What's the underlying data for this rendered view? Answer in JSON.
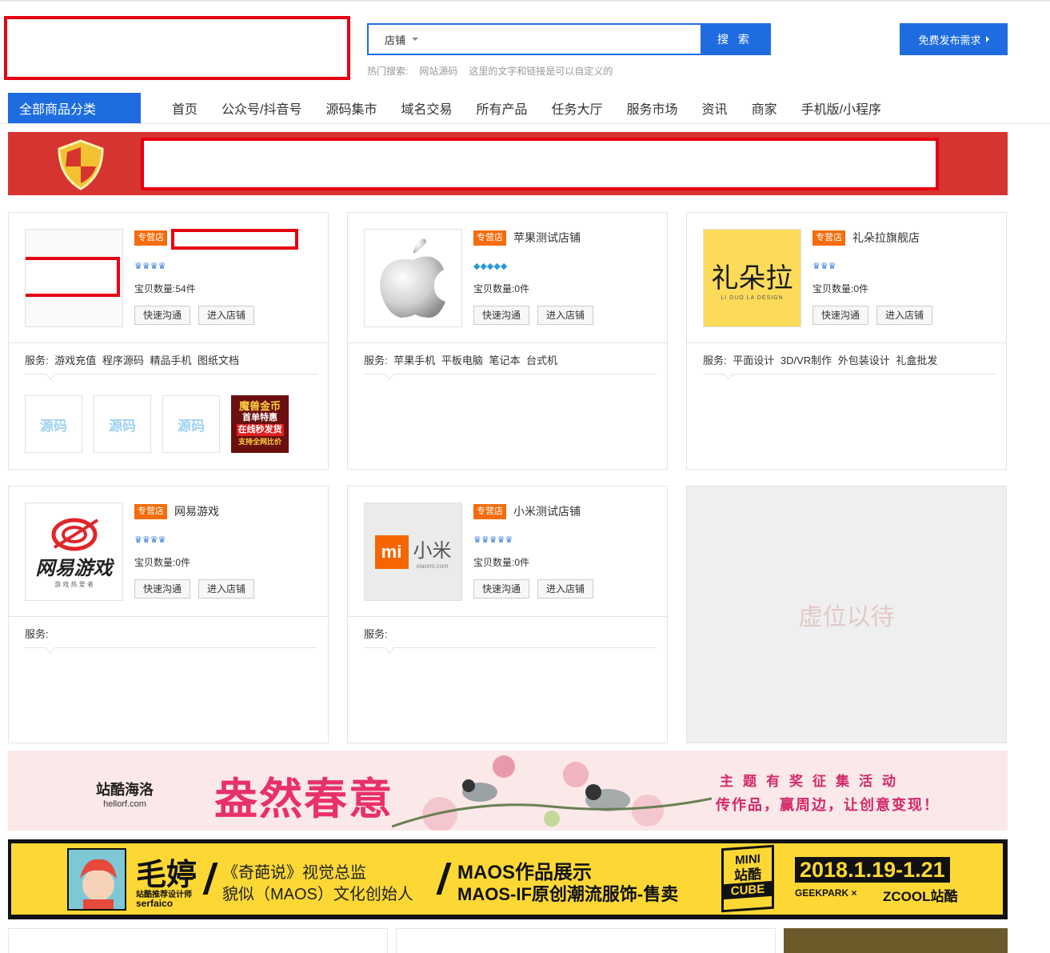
{
  "search": {
    "type_label": "店铺",
    "placeholder": "",
    "button_label": "搜 索",
    "hot_label": "热门搜索:",
    "hot_terms": [
      "网站源码",
      "这里的文字和链接是可以自定义的"
    ]
  },
  "publish_label": "免费发布需求",
  "nav": {
    "all_categories": "全部商品分类",
    "items": [
      "首页",
      "公众号/抖音号",
      "源码集市",
      "域名交易",
      "所有产品",
      "任务大厅",
      "服务市场",
      "资讯",
      "商家",
      "手机版/小程序"
    ]
  },
  "shops": [
    {
      "badge": "专营店",
      "name": "",
      "rating_icons": "♛♛♛♛",
      "count": "宝贝数量:54件",
      "chat_label": "快速沟通",
      "enter_label": "进入店铺",
      "services": "服务: 游戏充值 程序源码 精品手机 图纸文档",
      "products": [
        "源码",
        "源码",
        "源码"
      ],
      "gold_product": [
        "魔兽金币",
        "首单特惠",
        "在线秒发货",
        "支持全网比价"
      ]
    },
    {
      "badge": "专营店",
      "name": "苹果测试店铺",
      "rating_icons": "◆◆◆◆◆",
      "count": "宝贝数量:0件",
      "chat_label": "快速沟通",
      "enter_label": "进入店铺",
      "services": "服务: 苹果手机 平板电脑 笔记本 台式机"
    },
    {
      "badge": "专营店",
      "name": "礼朵拉旗舰店",
      "rating_icons": "♛♛♛",
      "count": "宝贝数量:0件",
      "chat_label": "快速沟通",
      "enter_label": "进入店铺",
      "services": "服务: 平面设计 3D/VR制作 外包装设计 礼盒批发",
      "logo_text": "礼朵拉",
      "logo_sub": "LI DUO LA DESIGN"
    },
    {
      "badge": "专营店",
      "name": "网易游戏",
      "rating_icons": "♛♛♛♛",
      "count": "宝贝数量:0件",
      "chat_label": "快速沟通",
      "enter_label": "进入店铺",
      "services": "服务:",
      "logo_text": "网易游戏",
      "logo_sub": "游 戏 热 爱 者"
    },
    {
      "badge": "专营店",
      "name": "小米测试店铺",
      "rating_icons": "♛♛♛♛♛",
      "count": "宝贝数量:0件",
      "chat_label": "快速沟通",
      "enter_label": "进入店铺",
      "services": "服务:",
      "logo_text": "小米",
      "logo_sub": "xiaomi.com"
    }
  ],
  "placeholder_text": "虚位以待",
  "ad1": {
    "brand": "站酷海洛",
    "brand_url": "hellorf.com",
    "title": "盎然春意",
    "right1": "主题有奖征集活动",
    "right2": "传作品，赢周边，让创意变现！"
  },
  "ad2": {
    "name": "毛婷",
    "sub1": "站酷推荐设计师",
    "sub2": "serfaico",
    "t1": "《奇葩说》视觉总监",
    "t2": "貌似（MAOS）文化创始人",
    "m1": "MAOS作品展示",
    "m2": "MAOS-IF原创潮流服饰-售卖",
    "mini": [
      "MINI",
      "站酷",
      "CUBE"
    ],
    "date": "2018.1.19-1.21",
    "geek": "GEEKPARK ×",
    "zcool": "ZCOOL站酷"
  },
  "colors": {
    "primary": "#1e6ce0",
    "badge": "#f56c0c",
    "banner_red": "#d63431",
    "highlight_red": "#e60012"
  }
}
